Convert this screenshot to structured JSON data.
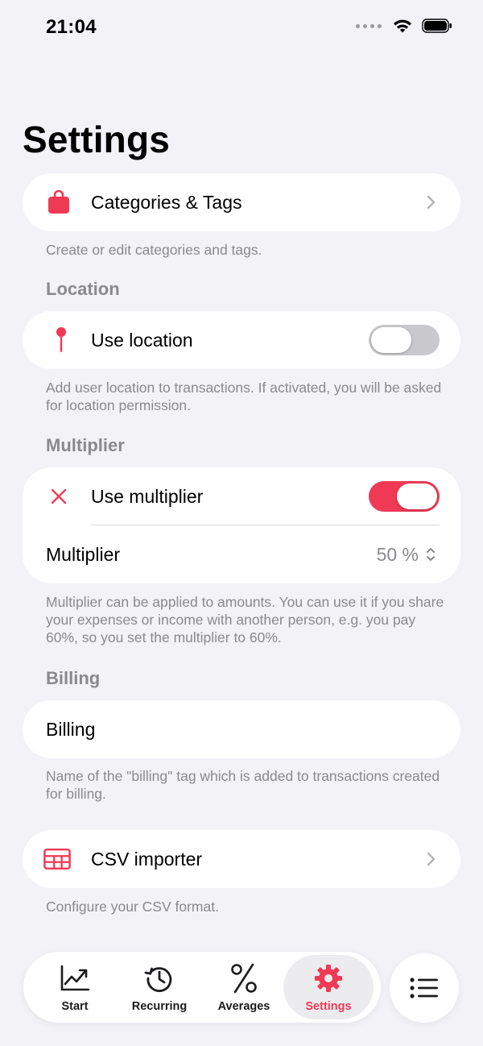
{
  "status_bar": {
    "time": "21:04",
    "signal_icon": "cellular-dots",
    "wifi_icon": "wifi-icon",
    "battery_icon": "battery-icon"
  },
  "page": {
    "title": "Settings"
  },
  "categories": {
    "label": "Categories & Tags",
    "icon": "bag-icon",
    "footer": "Create or edit categories and tags."
  },
  "location": {
    "header": "Location",
    "label": "Use location",
    "icon": "pin-icon",
    "enabled": false,
    "footer": "Add user location to transactions. If activated, you will be asked for location permission."
  },
  "multiplier": {
    "header": "Multiplier",
    "label": "Use multiplier",
    "icon": "x-icon",
    "enabled": true,
    "value_label": "Multiplier",
    "value": "50 %",
    "footer": "Multiplier can be applied to amounts. You can use it if you share your expenses or income with another person, e.g. you pay 60%, so you set the multiplier to 60%."
  },
  "billing": {
    "header": "Billing",
    "value": "Billing",
    "footer": "Name of the \"billing\" tag which is added to transactions created for billing."
  },
  "csv": {
    "label": "CSV importer",
    "icon": "table-icon",
    "footer": "Configure your CSV format."
  },
  "tab_bar": {
    "tabs": [
      {
        "label": "Start",
        "icon": "chart-icon"
      },
      {
        "label": "Recurring",
        "icon": "history-icon"
      },
      {
        "label": "Averages",
        "icon": "percent-icon"
      },
      {
        "label": "Settings",
        "icon": "gear-icon"
      }
    ],
    "active": "Settings",
    "menu_icon": "list-icon"
  },
  "colors": {
    "accent": "#f03a55",
    "background": "#f2f2f7",
    "secondary_text": "#8a8a8e"
  }
}
